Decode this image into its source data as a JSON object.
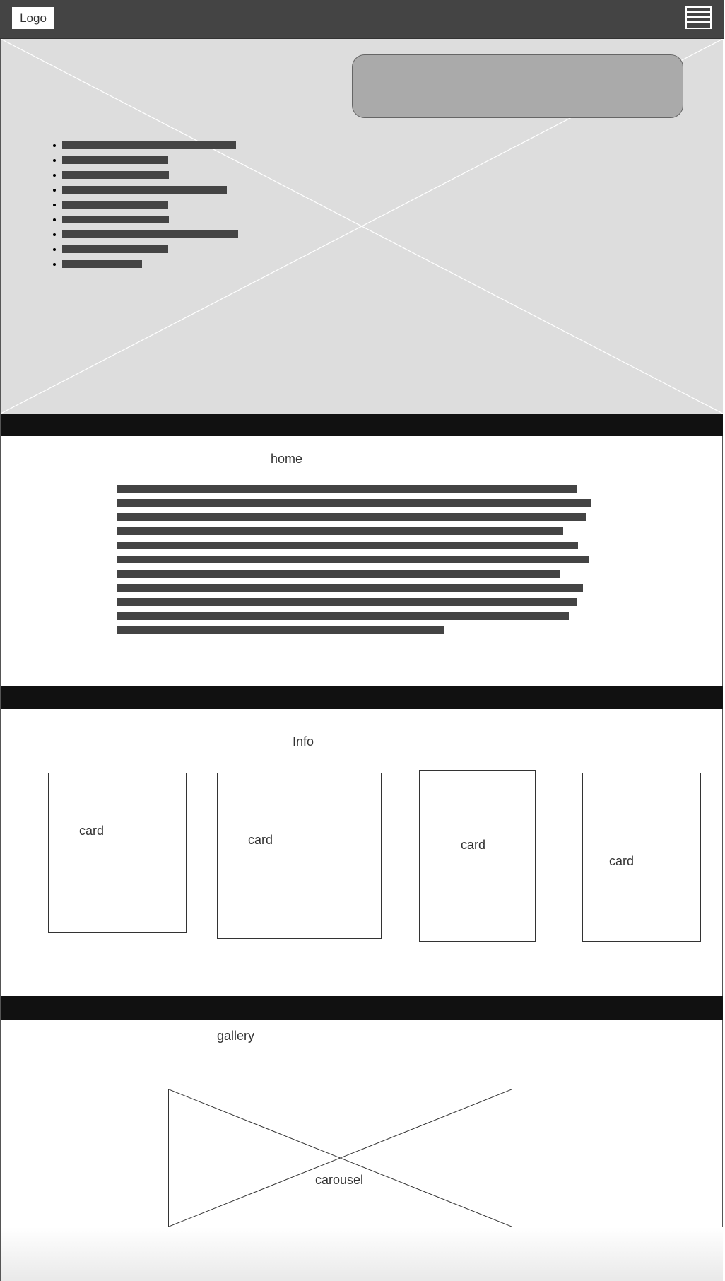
{
  "header": {
    "logo_label": "Logo",
    "menu_icon": "hamburger-menu-icon"
  },
  "hero": {
    "image_placeholder_icon": "image-placeholder-icon",
    "list_item_count": 9
  },
  "home": {
    "title": "home",
    "paragraph_lines": 11
  },
  "info": {
    "title": "Info",
    "cards": [
      {
        "label": "card"
      },
      {
        "label": "card"
      },
      {
        "label": "card"
      },
      {
        "label": "card"
      }
    ]
  },
  "gallery": {
    "title": "gallery",
    "carousel_label": "carousel"
  },
  "colors": {
    "header_bg": "#444444",
    "hero_bg": "#dddddd",
    "band": "#111111",
    "bar": "#444444",
    "hero_box": "#aaaaaa"
  }
}
